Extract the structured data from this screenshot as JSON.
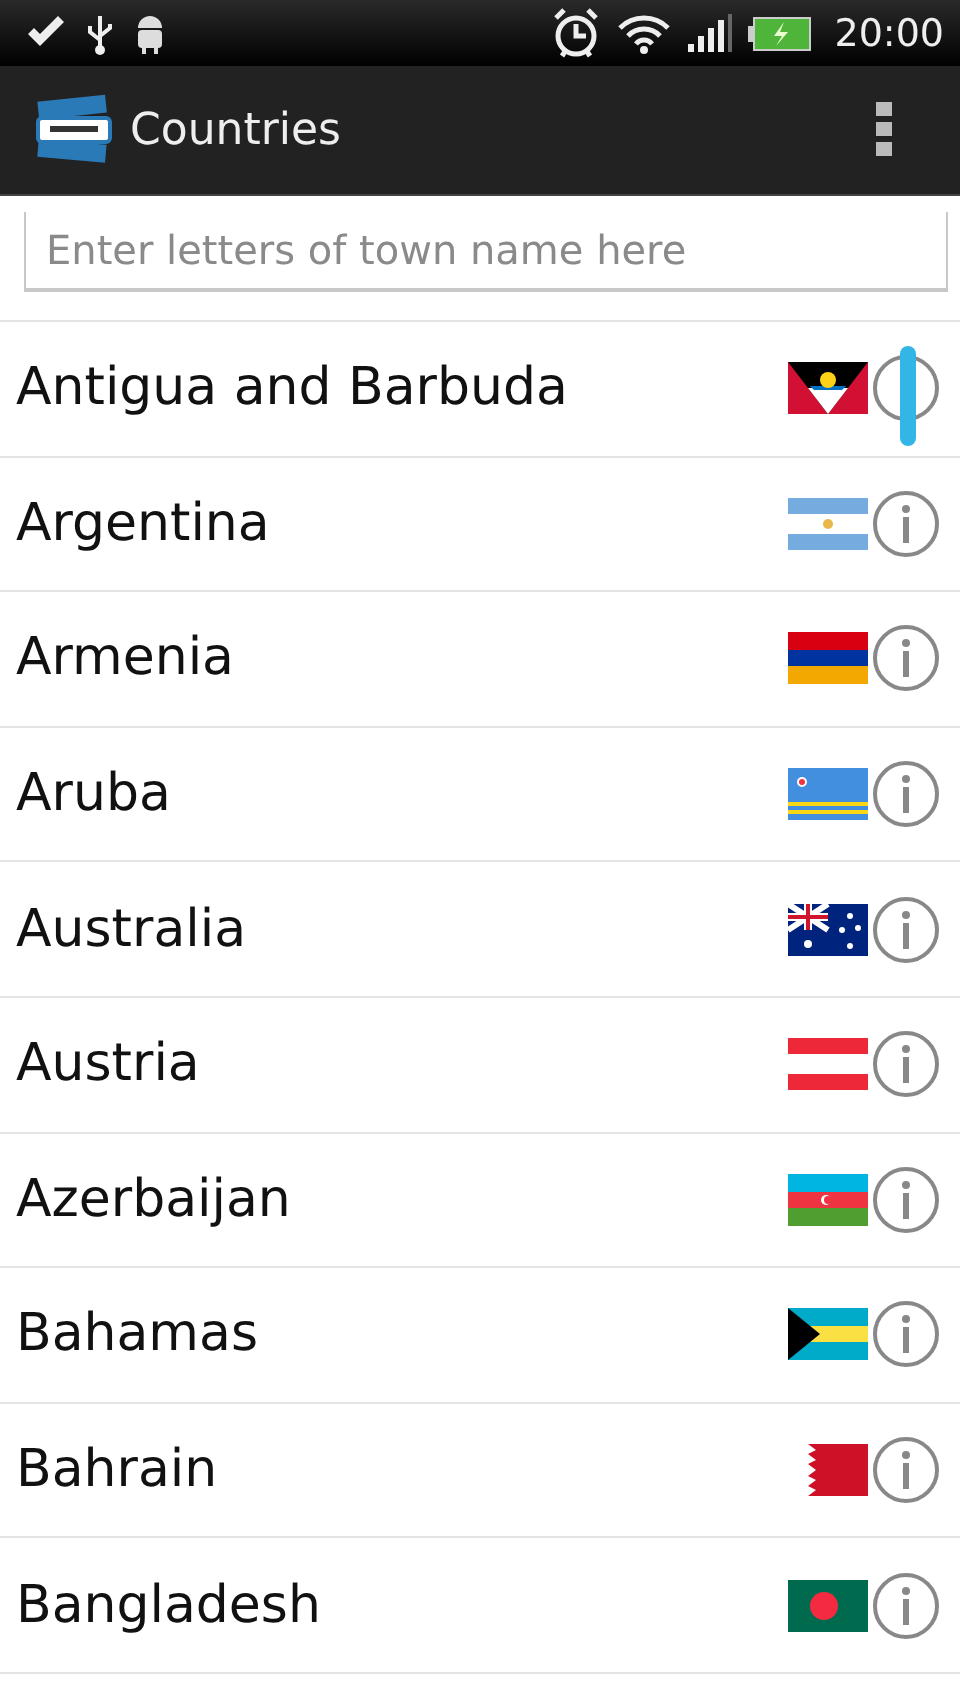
{
  "status_bar": {
    "time": "20:00"
  },
  "action_bar": {
    "title": "Countries"
  },
  "search": {
    "placeholder": "Enter letters of town name here"
  },
  "countries": [
    {
      "name": "Antigua and Barbuda",
      "kind": "antigua"
    },
    {
      "name": "Argentina",
      "kind": "argentina"
    },
    {
      "name": "Armenia",
      "kind": "armenia"
    },
    {
      "name": "Aruba",
      "kind": "aruba"
    },
    {
      "name": "Australia",
      "kind": "australia"
    },
    {
      "name": "Austria",
      "kind": "austria"
    },
    {
      "name": "Azerbaijan",
      "kind": "azerbaijan"
    },
    {
      "name": "Bahamas",
      "kind": "bahamas"
    },
    {
      "name": "Bahrain",
      "kind": "bahrain"
    },
    {
      "name": "Bangladesh",
      "kind": "bangladesh"
    }
  ]
}
